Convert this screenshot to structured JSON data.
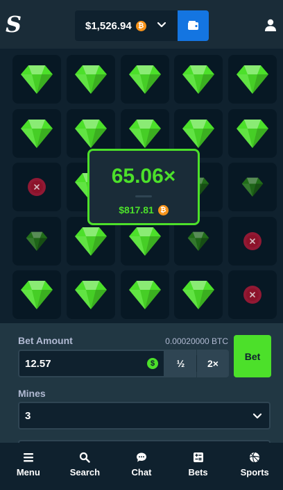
{
  "header": {
    "logo_icon": "stake-s-logo-icon",
    "balance": "$1,526.94",
    "currency_icon": "bitcoin-icon",
    "currency_symbol": "₿",
    "wallet_icon": "wallet-icon",
    "user_icon": "user-icon"
  },
  "board": {
    "rows": [
      [
        "gem",
        "gem",
        "gem",
        "gem",
        "gem"
      ],
      [
        "gem",
        "gem",
        "gem",
        "gem",
        "gem"
      ],
      [
        "mine",
        "gem",
        "gem",
        "gem-dim",
        "gem-dim"
      ],
      [
        "gem-dim",
        "gem",
        "gem",
        "gem-dim",
        "mine"
      ],
      [
        "gem",
        "gem",
        "gem",
        "gem",
        "mine"
      ]
    ],
    "colors": {
      "gem": "#4ce02a",
      "gem_dim": "#2a8a16",
      "mine": "#c0193a"
    }
  },
  "win": {
    "multiplier": "65.06×",
    "amount": "$817.81",
    "currency_symbol": "₿"
  },
  "controls": {
    "bet_amount_label": "Bet Amount",
    "btc_value": "0.00020000 BTC",
    "bet_value": "12.57",
    "usd_symbol": "$",
    "half_label": "½",
    "double_label": "2×",
    "bet_button": "Bet",
    "mines_label": "Mines",
    "mines_value": "3"
  },
  "nav": [
    {
      "label": "Menu",
      "icon": "menu-icon"
    },
    {
      "label": "Search",
      "icon": "search-icon"
    },
    {
      "label": "Chat",
      "icon": "chat-icon"
    },
    {
      "label": "Bets",
      "icon": "bets-icon"
    },
    {
      "label": "Sports",
      "icon": "sports-icon"
    }
  ],
  "theme": {
    "accent": "#4ce02a",
    "primary_blue": "#1475e1",
    "background": "#0f212e",
    "panel": "#213743"
  }
}
